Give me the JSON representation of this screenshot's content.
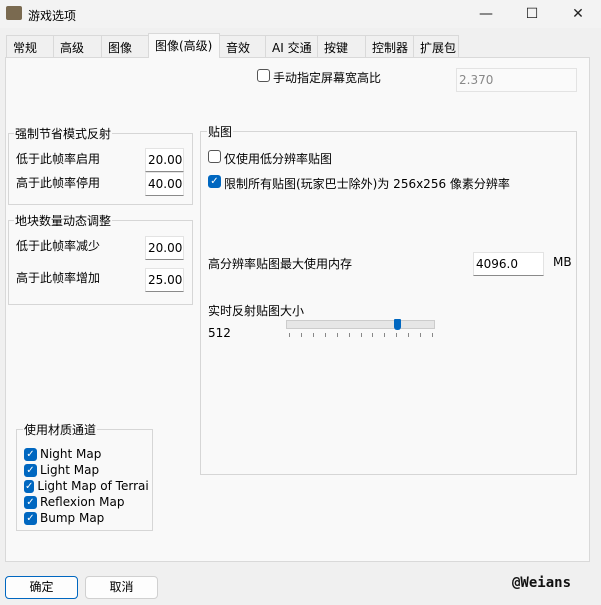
{
  "window": {
    "title": "游戏选项",
    "minimize": "—",
    "maximize": "☐",
    "close": "✕"
  },
  "tabs": [
    "常规",
    "高级",
    "图像",
    "图像(高级)",
    "音效",
    "AI 交通",
    "按键",
    "控制器",
    "扩展包"
  ],
  "aspect": {
    "label": "手动指定屏幕宽高比",
    "checked": false,
    "value": "2.370"
  },
  "reflection_group": {
    "title": "强制节省模式反射",
    "rows": [
      {
        "label": "低于此帧率启用",
        "value": "20.000"
      },
      {
        "label": "高于此帧率停用",
        "value": "40.000"
      }
    ]
  },
  "tile_group": {
    "title": "地块数量动态调整",
    "rows": [
      {
        "label": "低于此帧率减少",
        "value": "20.000"
      },
      {
        "label": "高于此帧率增加",
        "value": "25.000"
      }
    ]
  },
  "material_group": {
    "title": "使用材质通道",
    "items": [
      {
        "label": "Night Map",
        "checked": true
      },
      {
        "label": "Light Map",
        "checked": true
      },
      {
        "label": "Light Map of Terrain",
        "checked": true
      },
      {
        "label": "Reflexion Map",
        "checked": true
      },
      {
        "label": "Bump Map",
        "checked": true
      }
    ]
  },
  "texture_group": {
    "title": "贴图",
    "low_res": {
      "label": "仅使用低分辨率贴图",
      "checked": false
    },
    "limit": {
      "label": "限制所有贴图(玩家巴士除外)为 256x256 像素分辨率",
      "checked": true
    },
    "memory_label": "高分辨率贴图最大使用内存",
    "memory_value": "4096.0",
    "memory_unit": "MB",
    "reflect_label": "实时反射贴图大小",
    "reflect_value": "512",
    "slider_fraction": 0.75
  },
  "buttons": {
    "ok": "确定",
    "cancel": "取消"
  },
  "watermark": "@Weians"
}
